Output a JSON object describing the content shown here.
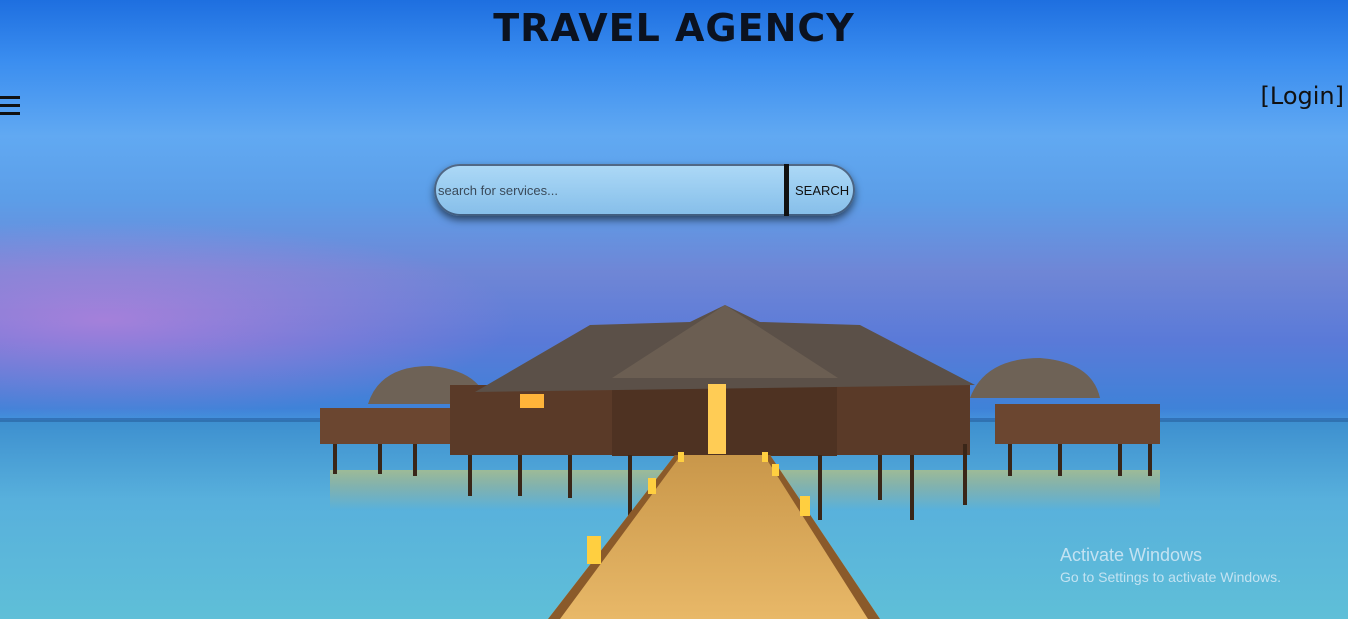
{
  "header": {
    "title": "TRAVEL AGENCY",
    "login_label": "[Login]"
  },
  "search": {
    "placeholder": "search for services...",
    "button_label": "SEARCH"
  },
  "watermark": {
    "line1": "Activate Windows",
    "line2": "Go to Settings to activate Windows."
  },
  "icons": {
    "menu": "hamburger-menu-icon"
  },
  "colors": {
    "title": "#0b1220",
    "sky": "#3b8ef0",
    "sea": "#5ab4d8"
  }
}
